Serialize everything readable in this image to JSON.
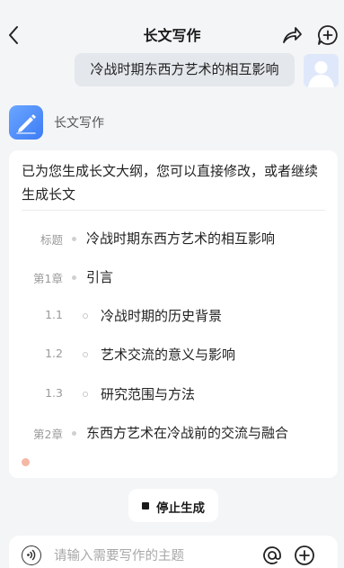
{
  "header": {
    "title": "长文写作"
  },
  "user_message": "冷战时期东西方艺术的相互影响",
  "bot": {
    "name": "长文写作"
  },
  "card": {
    "intro": "已为您生成长文大纲，您可以直接修改，或者继续生成长文",
    "outline": [
      {
        "label": "标题",
        "text": "冷战时期东西方艺术的相互影响",
        "level": 1
      },
      {
        "label": "第1章",
        "text": "引言",
        "level": 1
      },
      {
        "label": "1.1",
        "text": "冷战时期的历史背景",
        "level": 2
      },
      {
        "label": "1.2",
        "text": "艺术交流的意义与影响",
        "level": 2
      },
      {
        "label": "1.3",
        "text": "研究范围与方法",
        "level": 2
      },
      {
        "label": "第2章",
        "text": "东西方艺术在冷战前的交流与融合",
        "level": 1
      }
    ]
  },
  "stop_button": {
    "label": "停止生成"
  },
  "input": {
    "placeholder": "请输入需要写作的主题"
  },
  "icons": {
    "back": "chevron-left-icon",
    "share": "share-icon",
    "new_chat": "chat-plus-icon",
    "voice": "voice-icon",
    "mention": "at-icon",
    "add": "plus-icon",
    "stop": "stop-icon"
  },
  "colors": {
    "background": "#f4f5f7",
    "bot_avatar": "#3d7cf5",
    "loading_dot": "#f6b7a5"
  }
}
